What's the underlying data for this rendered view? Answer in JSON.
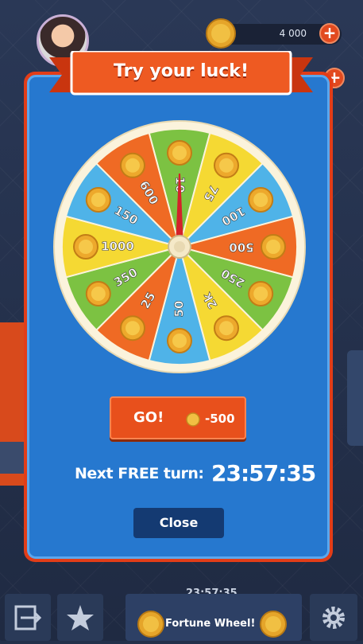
{
  "hud": {
    "coins": "4 000"
  },
  "dialog": {
    "title": "Try your luck!",
    "wheel_segments": [
      "10",
      "75",
      "100",
      "500",
      "250",
      "2k",
      "50",
      "25",
      "350",
      "1000",
      "150",
      "600"
    ],
    "go_label": "GO!",
    "go_cost": "-500",
    "next_free_label": "Next FREE turn:",
    "next_free_timer": "23:57:35",
    "close_label": "Close"
  },
  "bottom_bar": {
    "timer": "23:57:35",
    "fortune_wheel_label": "Fortune Wheel!"
  },
  "colors": {
    "accent_orange": "#e8501c",
    "dialog_blue": "#2678cf",
    "close_navy": "#143a72",
    "segments": [
      "#7cc242",
      "#f5d933",
      "#4fb3e8",
      "#ef6a24"
    ]
  }
}
